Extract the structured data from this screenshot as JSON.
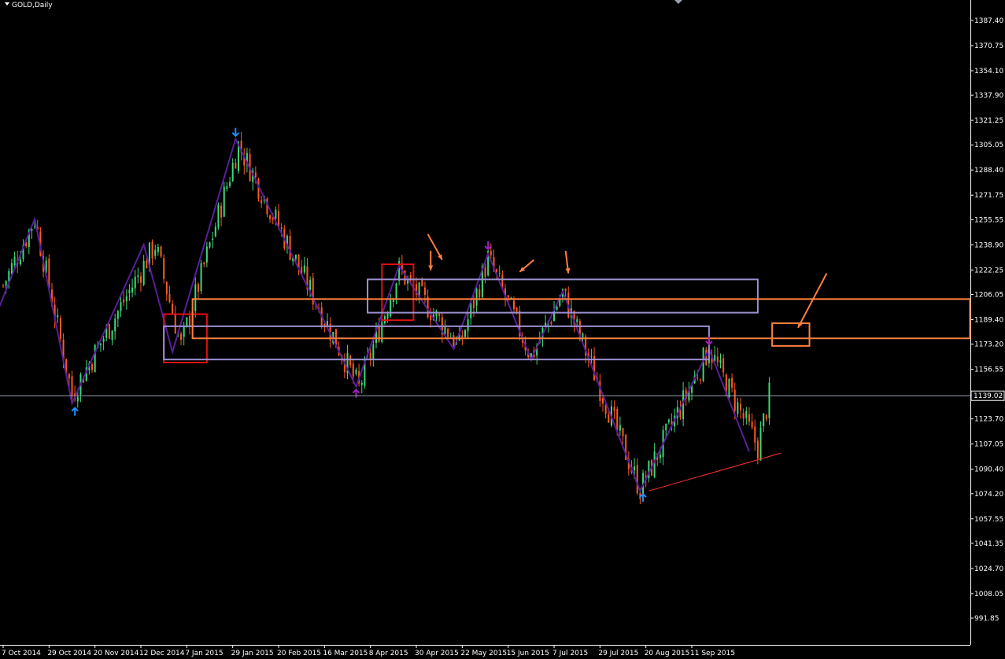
{
  "header": {
    "symbol_label": "GOLD,Daily"
  },
  "colors": {
    "background": "#000000",
    "axis": "#ffffff",
    "bull_candle": "#3dd97a",
    "bear_candle": "#ff5a1e",
    "zigzag": "#5a1e9a",
    "red_box": "#e01010",
    "orange_annot": "#ff8040",
    "lavender_box": "#9b8fd0",
    "current_price_line": "#9aa0b0",
    "price_tag_bg": "#000000",
    "arrow_up_low": "#1e90ff",
    "arrow_purple": "#a020c0",
    "trend_line": "#ff3030"
  },
  "chart_data": {
    "type": "candlestick",
    "title": "GOLD,Daily",
    "current_price": 1139.02,
    "current_price_label": "1139.02",
    "ylim": [
      991.85,
      1396.0
    ],
    "ylabels": [
      "1387.40",
      "1370.75",
      "1354.10",
      "1337.90",
      "1321.25",
      "1305.05",
      "1288.40",
      "1271.75",
      "1255.55",
      "1238.90",
      "1222.25",
      "1206.05",
      "1189.40",
      "1173.20",
      "1156.55",
      "1139.90",
      "1123.70",
      "1107.05",
      "1090.40",
      "1074.20",
      "1057.55",
      "1041.35",
      "1024.70",
      "1008.05",
      "991.85"
    ],
    "xlabels": [
      {
        "date": "7 Oct 2014",
        "bar": 0
      },
      {
        "date": "29 Oct 2014",
        "bar": 16
      },
      {
        "date": "20 Nov 2014",
        "bar": 32
      },
      {
        "date": "12 Dec 2014",
        "bar": 48
      },
      {
        "date": "7 Jan 2015",
        "bar": 64
      },
      {
        "date": "29 Jan 2015",
        "bar": 80
      },
      {
        "date": "20 Feb 2015",
        "bar": 96
      },
      {
        "date": "16 Mar 2015",
        "bar": 112
      },
      {
        "date": "8 Apr 2015",
        "bar": 128
      },
      {
        "date": "30 Apr 2015",
        "bar": 144
      },
      {
        "date": "22 May 2015",
        "bar": 160
      },
      {
        "date": "15 Jun 2015",
        "bar": 176
      },
      {
        "date": "7 Jul 2015",
        "bar": 192
      },
      {
        "date": "29 Jul 2015",
        "bar": 208
      },
      {
        "date": "20 Aug 2015",
        "bar": 224
      },
      {
        "date": "11 Sep 2015",
        "bar": 240
      }
    ],
    "swing_points": [
      {
        "bar": -3,
        "price": 1200
      },
      {
        "bar": 11,
        "price": 1256
      },
      {
        "bar": 24,
        "price": 1140
      },
      {
        "bar": 53,
        "price": 1239
      },
      {
        "bar": 62,
        "price": 1172
      },
      {
        "bar": 82,
        "price": 1305
      },
      {
        "bar": 124,
        "price": 1144
      },
      {
        "bar": 138,
        "price": 1222
      },
      {
        "bar": 159,
        "price": 1172
      },
      {
        "bar": 169,
        "price": 1230
      },
      {
        "bar": 184,
        "price": 1165
      },
      {
        "bar": 195,
        "price": 1207
      },
      {
        "bar": 222,
        "price": 1077
      },
      {
        "bar": 246,
        "price": 1170
      },
      {
        "bar": 263,
        "price": 1105
      },
      {
        "bar": 267,
        "price": 1139
      }
    ],
    "zigzag": [
      {
        "bar": -3,
        "price": 1190
      },
      {
        "bar": 11,
        "price": 1256
      },
      {
        "bar": 24,
        "price": 1134
      },
      {
        "bar": 49,
        "price": 1239
      },
      {
        "bar": 59,
        "price": 1168
      },
      {
        "bar": 81,
        "price": 1309
      },
      {
        "bar": 123,
        "price": 1145
      },
      {
        "bar": 138,
        "price": 1225
      },
      {
        "bar": 157,
        "price": 1170
      },
      {
        "bar": 169,
        "price": 1233
      },
      {
        "bar": 184,
        "price": 1163
      },
      {
        "bar": 195,
        "price": 1208
      },
      {
        "bar": 222,
        "price": 1076
      },
      {
        "bar": 246,
        "price": 1170
      },
      {
        "bar": 260,
        "price": 1102
      }
    ],
    "arrows": [
      {
        "bar": 25,
        "price": 1131,
        "dir": "up",
        "color": "blue"
      },
      {
        "bar": 81,
        "price": 1311,
        "dir": "down",
        "color": "blue"
      },
      {
        "bar": 123,
        "price": 1143,
        "dir": "up",
        "color": "purple"
      },
      {
        "bar": 169,
        "price": 1236,
        "dir": "down",
        "color": "purple"
      },
      {
        "bar": 223,
        "price": 1074,
        "dir": "up",
        "color": "blue"
      },
      {
        "bar": 246,
        "price": 1173,
        "dir": "down",
        "color": "purple"
      }
    ],
    "boxes": [
      {
        "kind": "red",
        "bar_from": 56,
        "bar_to": 71,
        "price_top": 1193,
        "price_bottom": 1161
      },
      {
        "kind": "red",
        "bar_from": 132,
        "bar_to": 143,
        "price_top": 1226,
        "price_bottom": 1189
      },
      {
        "kind": "lavender",
        "bar_from": 127,
        "bar_to": 263,
        "price_top": 1216,
        "price_bottom": 1194
      },
      {
        "kind": "lavender",
        "bar_from": 56,
        "bar_to": 246,
        "price_top": 1185,
        "price_bottom": 1163
      },
      {
        "kind": "orange",
        "bar_from": 66,
        "bar_to": 344,
        "price_top": 1203,
        "price_bottom": 1177
      },
      {
        "kind": "orange",
        "bar_from": 268,
        "bar_to": 281,
        "price_top": 1187,
        "price_bottom": 1172
      }
    ],
    "orange_arrows": [
      {
        "from_bar": 148,
        "from_price": 1246,
        "to_bar": 153,
        "to_price": 1229
      },
      {
        "from_bar": 149,
        "from_price": 1235,
        "to_bar": 149,
        "to_price": 1222
      },
      {
        "from_bar": 185,
        "from_price": 1229,
        "to_bar": 180,
        "to_price": 1221
      },
      {
        "from_bar": 196,
        "from_price": 1235,
        "to_bar": 197,
        "to_price": 1220
      },
      {
        "from_bar": 287,
        "from_price": 1220,
        "to_bar": 277,
        "to_price": 1184
      }
    ],
    "trend_line": {
      "from_bar": 225,
      "from_price": 1076,
      "to_bar": 271,
      "to_price": 1101
    },
    "grid": false,
    "legend": "none"
  }
}
